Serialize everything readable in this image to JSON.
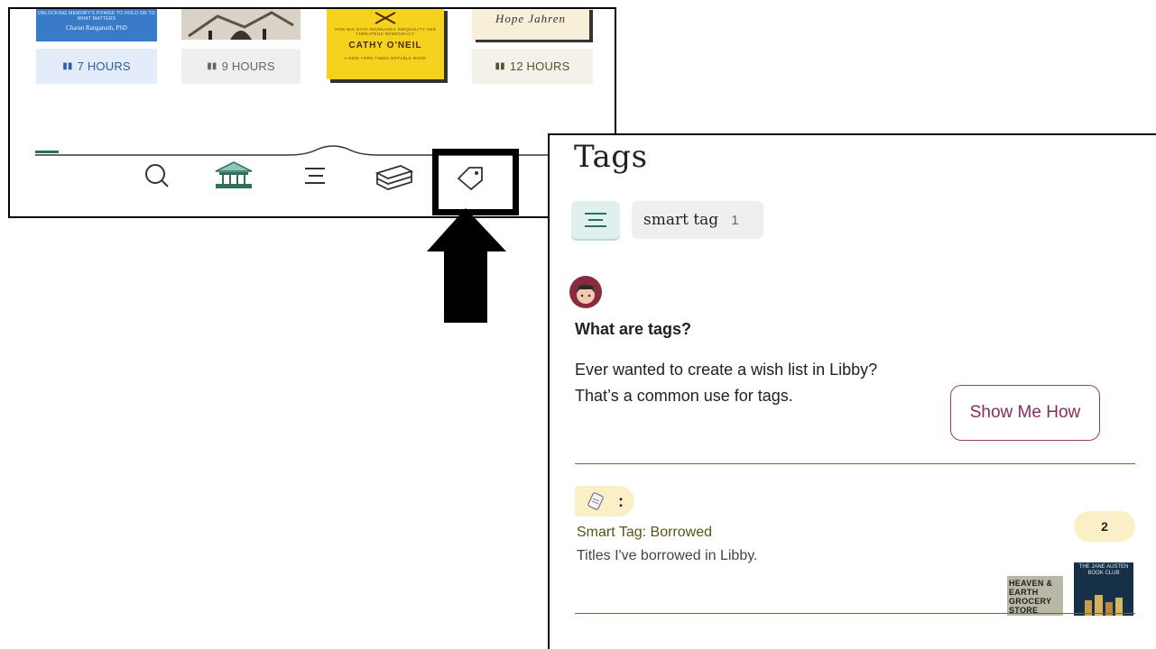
{
  "top_panel": {
    "covers": [
      {
        "id": "book-1",
        "small_text": "UNLOCKING MEMORY'S POWER TO HOLD ON TO WHAT MATTERS",
        "author": "Charan Ranganath, PhD",
        "color": "#3a7bc8"
      },
      {
        "id": "book-2",
        "color": "#d9d3c7"
      },
      {
        "id": "book-3",
        "small_text": "HOW BIG DATA INCREASES INEQUALITY AND THREATENS DEMOCRACY",
        "author": "CATHY O'NEIL",
        "footer": "A NEW YORK TIMES NOTABLE BOOK",
        "color": "#f5d21e"
      },
      {
        "id": "book-4",
        "author": "Hope Jahren",
        "color": "#f7efd8"
      }
    ],
    "hours": [
      "7 HOURS",
      "9 HOURS",
      "12 HOURS"
    ],
    "nav_icons": [
      "search-icon",
      "library-icon",
      "menu-icon",
      "shelf-icon",
      "tag-icon"
    ]
  },
  "tags_panel": {
    "title": "Tags",
    "filter_chip": {
      "label": "smart tag",
      "count": "1"
    },
    "intro": {
      "heading": "What are tags?",
      "line1": "Ever wanted to create a wish list in Libby?",
      "line2": "That’s a common use for tags.",
      "button": "Show Me How"
    },
    "tag_item": {
      "menu_glyph": ":",
      "name": "Smart Tag: Borrowed",
      "description": "Titles I've borrowed in Libby.",
      "count": "2",
      "thumb_1": "HEAVEN & EARTH GROCERY STORE",
      "thumb_2": "THE JANE AUSTEN BOOK CLUB"
    }
  },
  "colors": {
    "accent_teal": "#dff0ee",
    "button_maroon": "#8a2a5a",
    "tag_yellow": "#fbefc8",
    "divider_olive": "#6f6a2a"
  }
}
